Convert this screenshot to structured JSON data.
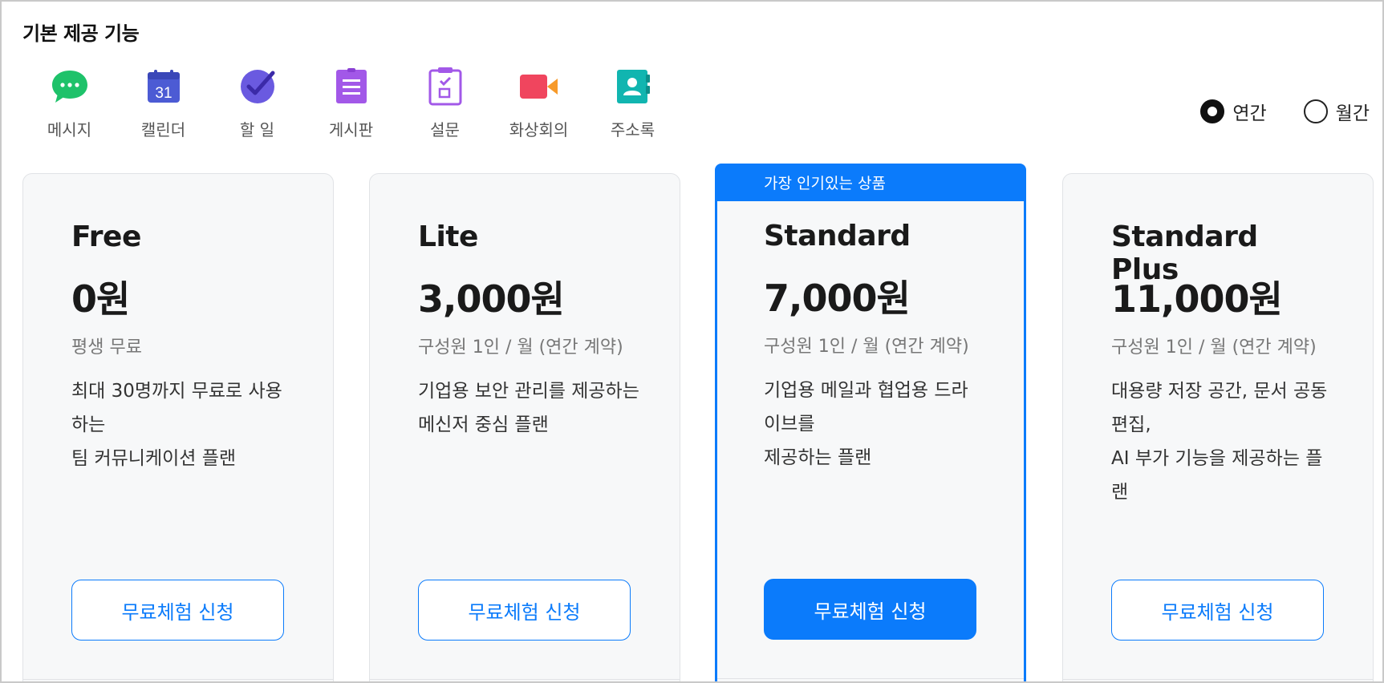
{
  "section_title": "기본 제공 기능",
  "features": [
    {
      "label": "메시지",
      "icon": "message-icon"
    },
    {
      "label": "캘린더",
      "icon": "calendar-icon",
      "icon_text": "31"
    },
    {
      "label": "할 일",
      "icon": "todo-icon"
    },
    {
      "label": "게시판",
      "icon": "board-icon"
    },
    {
      "label": "설문",
      "icon": "survey-icon"
    },
    {
      "label": "화상회의",
      "icon": "video-call-icon"
    },
    {
      "label": "주소록",
      "icon": "address-book-icon"
    }
  ],
  "billing": {
    "options": [
      {
        "label": "연간",
        "selected": true
      },
      {
        "label": "월간",
        "selected": false
      }
    ]
  },
  "plans": [
    {
      "name": "Free",
      "price": "0원",
      "period": "평생 무료",
      "description": "최대 30명까지 무료로 사용하는\n팀 커뮤니케이션 플랜",
      "cta": "무료체험 신청",
      "featured": false
    },
    {
      "name": "Lite",
      "price": "3,000원",
      "period": "구성원 1인 / 월 (연간 계약)",
      "description": "기업용 보안 관리를 제공하는\n메신저 중심 플랜",
      "cta": "무료체험 신청",
      "featured": false
    },
    {
      "name": "Standard",
      "price": "7,000원",
      "period": "구성원 1인 / 월 (연간 계약)",
      "description": "기업용 메일과 협업용 드라이브를\n제공하는 플랜",
      "cta": "무료체험 신청",
      "featured": true,
      "badge": "가장 인기있는 상품"
    },
    {
      "name": "Standard Plus",
      "price": "11,000원",
      "period": "구성원 1인 / 월 (연간 계약)",
      "description": "대용량 저장 공간, 문서 공동 편집,\nAI 부가 기능을 제공하는 플랜",
      "cta": "무료체험 신청",
      "featured": false
    }
  ],
  "colors": {
    "accent": "#0b7bfb",
    "card_bg": "#f7f8f9",
    "message_icon": "#1ec26a",
    "calendar_icon": "#4c5bd4",
    "todo_icon": "#6a5ae0",
    "board_icon": "#a258e8",
    "survey_icon": "#a258e8",
    "video_icon": "#f0455e",
    "address_icon": "#11b5b0"
  }
}
